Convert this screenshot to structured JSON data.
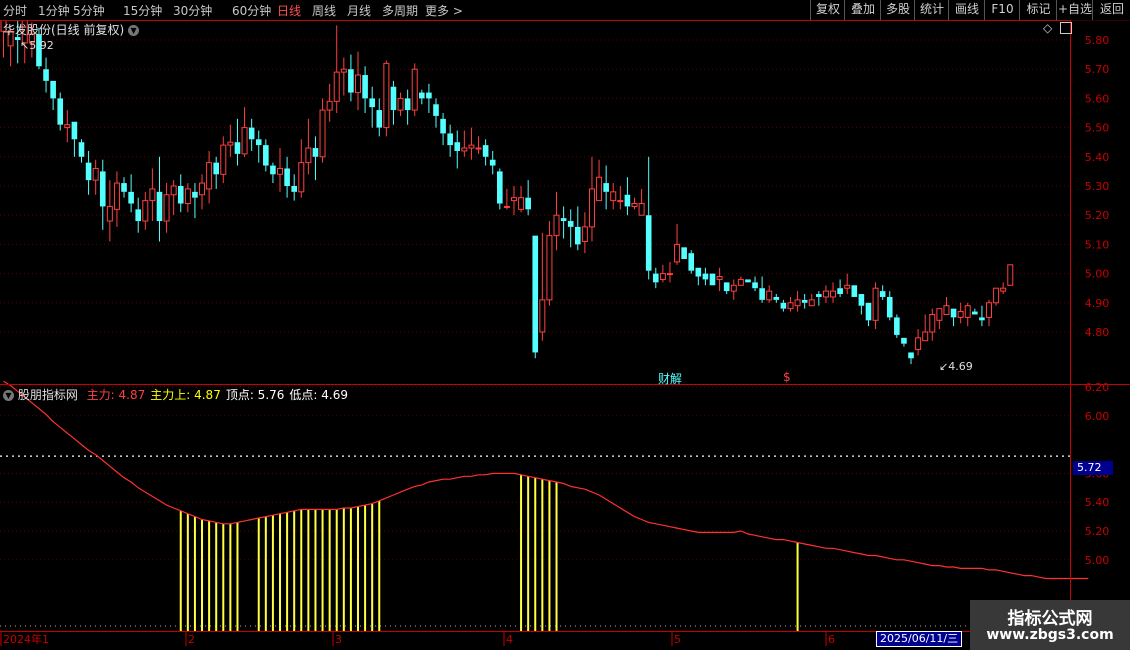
{
  "toolbar": {
    "periods": [
      "分时",
      "1分钟",
      "5分钟",
      "15分钟",
      "30分钟",
      "60分钟",
      "日线",
      "周线",
      "月线",
      "多周期",
      "更多 >"
    ],
    "active_period": "日线",
    "tools": [
      "复权",
      "叠加",
      "多股",
      "统计",
      "画线",
      "F10",
      "标记",
      "+自选",
      "返回"
    ]
  },
  "main_panel": {
    "title": "华发股份(日线 前复权)",
    "high_marker": "5.92",
    "low_marker": "4.69",
    "events": [
      "财",
      "解",
      "$"
    ],
    "yaxis_ticks": [
      "5.80",
      "5.70",
      "5.60",
      "5.50",
      "5.40",
      "5.30",
      "5.20",
      "5.10",
      "5.00",
      "4.90",
      "4.80"
    ]
  },
  "indicator_panel": {
    "name": "股朋指标网",
    "labels": [
      {
        "name": "主力:",
        "value": "4.87",
        "color": "#ff4040"
      },
      {
        "name": "主力上:",
        "value": "4.87",
        "color": "#ffff00"
      },
      {
        "name": "顶点:",
        "value": "5.76",
        "color": "#ffffff"
      },
      {
        "name": "低点:",
        "value": "4.69",
        "color": "#ffffff"
      }
    ],
    "yaxis_ticks": [
      "6.20",
      "6.00",
      "5.60",
      "5.40",
      "5.20",
      "5.00"
    ],
    "level_label": "5.72"
  },
  "xaxis": {
    "labels": [
      "2024年1",
      "2",
      "3",
      "4",
      "5",
      "6"
    ],
    "cursor_date": "2025/06/11/三"
  },
  "watermark": {
    "line1": "指标公式网",
    "line2": "www.zbgs3.com"
  },
  "colors": {
    "up": "#ff4040",
    "down": "#54ffff",
    "line": "#ff3030",
    "bars": "#ffff40",
    "axis": "#c80000"
  },
  "chart_data": {
    "type": "candlestick",
    "ohlc": [
      [
        5.83,
        5.9,
        5.8,
        5.74
      ],
      [
        5.78,
        5.83,
        5.84,
        5.71
      ],
      [
        5.81,
        5.8,
        5.88,
        5.72
      ],
      [
        5.79,
        5.87,
        5.9,
        5.72
      ],
      [
        5.79,
        5.82,
        5.86,
        5.74
      ],
      [
        5.82,
        5.71,
        5.84,
        5.7
      ],
      [
        5.7,
        5.66,
        5.74,
        5.62
      ],
      [
        5.66,
        5.6,
        5.66,
        5.56
      ],
      [
        5.6,
        5.51,
        5.62,
        5.49
      ],
      [
        5.5,
        5.51,
        5.56,
        5.45
      ],
      [
        5.52,
        5.46,
        5.52,
        5.4
      ],
      [
        5.45,
        5.4,
        5.46,
        5.38
      ],
      [
        5.38,
        5.32,
        5.42,
        5.27
      ],
      [
        5.32,
        5.36,
        5.39,
        5.27
      ],
      [
        5.35,
        5.23,
        5.39,
        5.15
      ],
      [
        5.18,
        5.23,
        5.32,
        5.11
      ],
      [
        5.22,
        5.31,
        5.35,
        5.16
      ],
      [
        5.31,
        5.28,
        5.33,
        5.26
      ],
      [
        5.28,
        5.24,
        5.34,
        5.21
      ],
      [
        5.22,
        5.18,
        5.26,
        5.14
      ],
      [
        5.18,
        5.25,
        5.28,
        5.15
      ],
      [
        5.25,
        5.29,
        5.36,
        5.18
      ],
      [
        5.28,
        5.18,
        5.4,
        5.11
      ],
      [
        5.18,
        5.27,
        5.31,
        5.14
      ],
      [
        5.27,
        5.3,
        5.32,
        5.2
      ],
      [
        5.3,
        5.24,
        5.34,
        5.21
      ],
      [
        5.24,
        5.29,
        5.31,
        5.21
      ],
      [
        5.28,
        5.26,
        5.31,
        5.19
      ],
      [
        5.27,
        5.31,
        5.34,
        5.22
      ],
      [
        5.29,
        5.38,
        5.42,
        5.24
      ],
      [
        5.38,
        5.34,
        5.4,
        5.29
      ],
      [
        5.34,
        5.44,
        5.47,
        5.31
      ],
      [
        5.44,
        5.45,
        5.51,
        5.4
      ],
      [
        5.45,
        5.41,
        5.53,
        5.37
      ],
      [
        5.41,
        5.5,
        5.57,
        5.4
      ],
      [
        5.5,
        5.46,
        5.53,
        5.42
      ],
      [
        5.46,
        5.44,
        5.49,
        5.38
      ],
      [
        5.44,
        5.37,
        5.46,
        5.35
      ],
      [
        5.37,
        5.34,
        5.38,
        5.31
      ],
      [
        5.34,
        5.36,
        5.43,
        5.28
      ],
      [
        5.36,
        5.3,
        5.4,
        5.26
      ],
      [
        5.3,
        5.28,
        5.34,
        5.25
      ],
      [
        5.28,
        5.38,
        5.46,
        5.26
      ],
      [
        5.38,
        5.43,
        5.53,
        5.34
      ],
      [
        5.43,
        5.4,
        5.47,
        5.32
      ],
      [
        5.4,
        5.56,
        5.6,
        5.38
      ],
      [
        5.56,
        5.59,
        5.65,
        5.52
      ],
      [
        5.59,
        5.69,
        5.85,
        5.55
      ],
      [
        5.69,
        5.7,
        5.74,
        5.61
      ],
      [
        5.7,
        5.62,
        5.75,
        5.59
      ],
      [
        5.62,
        5.68,
        5.76,
        5.56
      ],
      [
        5.68,
        5.6,
        5.71,
        5.55
      ],
      [
        5.6,
        5.57,
        5.64,
        5.5
      ],
      [
        5.56,
        5.5,
        5.6,
        5.47
      ],
      [
        5.5,
        5.72,
        5.73,
        5.47
      ],
      [
        5.64,
        5.56,
        5.66,
        5.51
      ],
      [
        5.56,
        5.6,
        5.62,
        5.54
      ],
      [
        5.6,
        5.56,
        5.63,
        5.51
      ],
      [
        5.56,
        5.7,
        5.72,
        5.54
      ],
      [
        5.62,
        5.6,
        5.63,
        5.58
      ],
      [
        5.62,
        5.6,
        5.65,
        5.55
      ],
      [
        5.58,
        5.54,
        5.6,
        5.5
      ],
      [
        5.53,
        5.48,
        5.55,
        5.44
      ],
      [
        5.48,
        5.44,
        5.51,
        5.4
      ],
      [
        5.45,
        5.42,
        5.49,
        5.36
      ],
      [
        5.42,
        5.43,
        5.49,
        5.4
      ],
      [
        5.43,
        5.44,
        5.5,
        5.39
      ],
      [
        5.43,
        5.43,
        5.47,
        5.41
      ],
      [
        5.44,
        5.4,
        5.46,
        5.37
      ],
      [
        5.39,
        5.37,
        5.42,
        5.34
      ],
      [
        5.35,
        5.24,
        5.36,
        5.22
      ],
      [
        5.23,
        5.23,
        5.29,
        5.22
      ],
      [
        5.25,
        5.26,
        5.3,
        5.2
      ],
      [
        5.22,
        5.26,
        5.3,
        5.21
      ],
      [
        5.26,
        5.22,
        5.32,
        5.2
      ],
      [
        5.13,
        4.73,
        5.13,
        4.71
      ],
      [
        4.8,
        4.91,
        5.14,
        4.77
      ],
      [
        4.91,
        5.13,
        5.18,
        4.89
      ],
      [
        5.13,
        5.2,
        5.28,
        5.08
      ],
      [
        5.19,
        5.18,
        5.23,
        5.12
      ],
      [
        5.18,
        5.16,
        5.22,
        5.09
      ],
      [
        5.16,
        5.1,
        5.23,
        5.08
      ],
      [
        5.11,
        5.16,
        5.21,
        5.07
      ],
      [
        5.16,
        5.29,
        5.4,
        5.11
      ],
      [
        5.25,
        5.33,
        5.39,
        5.25
      ],
      [
        5.31,
        5.28,
        5.37,
        5.22
      ],
      [
        5.25,
        5.28,
        5.31,
        5.22
      ],
      [
        5.25,
        5.25,
        5.3,
        5.22
      ],
      [
        5.27,
        5.23,
        5.33,
        5.2
      ],
      [
        5.23,
        5.24,
        5.26,
        5.22
      ],
      [
        5.2,
        5.24,
        5.29,
        5.21
      ],
      [
        5.2,
        5.01,
        5.4,
        4.98
      ],
      [
        5.0,
        4.97,
        5.02,
        4.95
      ],
      [
        4.98,
        5.0,
        5.03,
        4.97
      ],
      [
        5.0,
        5.0,
        5.04,
        4.97
      ],
      [
        5.04,
        5.1,
        5.17,
        5.03
      ],
      [
        5.09,
        5.05,
        5.09,
        5.05
      ],
      [
        5.07,
        5.01,
        5.08,
        5.0
      ],
      [
        5.02,
        4.99,
        5.02,
        4.96
      ],
      [
        5.0,
        4.98,
        5.02,
        4.96
      ],
      [
        5.0,
        4.96,
        5.0,
        4.96
      ],
      [
        4.98,
        4.99,
        5.02,
        4.94
      ],
      [
        4.97,
        4.94,
        4.97,
        4.93
      ],
      [
        4.94,
        4.96,
        4.98,
        4.91
      ],
      [
        4.96,
        4.98,
        4.99,
        4.96
      ],
      [
        4.98,
        4.97,
        4.98,
        4.97
      ],
      [
        4.97,
        4.95,
        4.99,
        4.94
      ],
      [
        4.95,
        4.91,
        4.99,
        4.9
      ],
      [
        4.91,
        4.94,
        4.96,
        4.9
      ],
      [
        4.92,
        4.91,
        4.93,
        4.9
      ],
      [
        4.9,
        4.88,
        4.91,
        4.87
      ],
      [
        4.88,
        4.9,
        4.92,
        4.87
      ],
      [
        4.89,
        4.91,
        4.94,
        4.87
      ],
      [
        4.91,
        4.9,
        4.93,
        4.88
      ],
      [
        4.89,
        4.91,
        4.93,
        4.89
      ],
      [
        4.93,
        4.92,
        4.94,
        4.89
      ],
      [
        4.92,
        4.94,
        4.96,
        4.9
      ],
      [
        4.92,
        4.94,
        4.97,
        4.9
      ],
      [
        4.95,
        4.93,
        4.98,
        4.92
      ],
      [
        4.95,
        4.96,
        5.0,
        4.93
      ],
      [
        4.96,
        4.92,
        4.96,
        4.92
      ],
      [
        4.93,
        4.89,
        4.93,
        4.86
      ],
      [
        4.9,
        4.84,
        4.9,
        4.82
      ],
      [
        4.84,
        4.95,
        4.97,
        4.81
      ],
      [
        4.94,
        4.92,
        4.96,
        4.91
      ],
      [
        4.92,
        4.85,
        4.94,
        4.84
      ],
      [
        4.85,
        4.79,
        4.86,
        4.78
      ],
      [
        4.78,
        4.76,
        4.78,
        4.75
      ],
      [
        4.73,
        4.71,
        4.73,
        4.69
      ],
      [
        4.74,
        4.78,
        4.81,
        4.72
      ],
      [
        4.77,
        4.8,
        4.86,
        4.77
      ],
      [
        4.8,
        4.86,
        4.88,
        4.77
      ],
      [
        4.84,
        4.88,
        4.88,
        4.81
      ],
      [
        4.86,
        4.89,
        4.92,
        4.86
      ],
      [
        4.88,
        4.85,
        4.88,
        4.82
      ],
      [
        4.85,
        4.87,
        4.9,
        4.83
      ],
      [
        4.85,
        4.89,
        4.9,
        4.82
      ],
      [
        4.87,
        4.86,
        4.88,
        4.86
      ],
      [
        4.85,
        4.84,
        4.89,
        4.82
      ],
      [
        4.85,
        4.9,
        4.91,
        4.82
      ],
      [
        4.9,
        4.95,
        4.95,
        4.89
      ],
      [
        4.94,
        4.95,
        4.97,
        4.93
      ],
      [
        4.96,
        5.03,
        5.03,
        4.96
      ]
    ],
    "indicator_line": [
      6.24,
      6.21,
      6.17,
      6.13,
      6.09,
      6.05,
      6.01,
      5.96,
      5.92,
      5.88,
      5.84,
      5.8,
      5.76,
      5.73,
      5.69,
      5.65,
      5.61,
      5.57,
      5.54,
      5.5,
      5.47,
      5.44,
      5.41,
      5.38,
      5.36,
      5.34,
      5.32,
      5.3,
      5.28,
      5.27,
      5.26,
      5.25,
      5.25,
      5.26,
      5.27,
      5.28,
      5.29,
      5.3,
      5.31,
      5.32,
      5.33,
      5.34,
      5.35,
      5.35,
      5.35,
      5.35,
      5.35,
      5.35,
      5.36,
      5.36,
      5.37,
      5.38,
      5.39,
      5.41,
      5.43,
      5.45,
      5.47,
      5.49,
      5.51,
      5.52,
      5.54,
      5.55,
      5.56,
      5.56,
      5.57,
      5.58,
      5.58,
      5.59,
      5.59,
      5.6,
      5.6,
      5.6,
      5.6,
      5.59,
      5.58,
      5.57,
      5.56,
      5.55,
      5.54,
      5.53,
      5.51,
      5.5,
      5.49,
      5.47,
      5.45,
      5.42,
      5.39,
      5.36,
      5.33,
      5.3,
      5.28,
      5.26,
      5.25,
      5.24,
      5.23,
      5.22,
      5.21,
      5.2,
      5.19,
      5.19,
      5.19,
      5.19,
      5.19,
      5.19,
      5.2,
      5.18,
      5.17,
      5.16,
      5.15,
      5.14,
      5.14,
      5.13,
      5.12,
      5.11,
      5.1,
      5.09,
      5.08,
      5.08,
      5.07,
      5.06,
      5.05,
      5.04,
      5.03,
      5.03,
      5.02,
      5.01,
      5.0,
      5.0,
      4.99,
      4.98,
      4.97,
      4.96,
      4.96,
      4.95,
      4.95,
      4.94,
      4.94,
      4.94,
      4.94,
      4.93,
      4.93,
      4.92,
      4.91,
      4.9,
      4.89,
      4.89,
      4.88,
      4.87,
      4.87,
      4.87,
      4.87,
      4.87,
      4.87,
      4.87
    ],
    "signal_ranges": [
      [
        25,
        33
      ],
      [
        36,
        53
      ],
      [
        73,
        78
      ],
      [
        112,
        112
      ]
    ],
    "ylim_main": [
      4.69,
      5.92
    ],
    "ylim_indicator": [
      4.87,
      6.24
    ]
  }
}
